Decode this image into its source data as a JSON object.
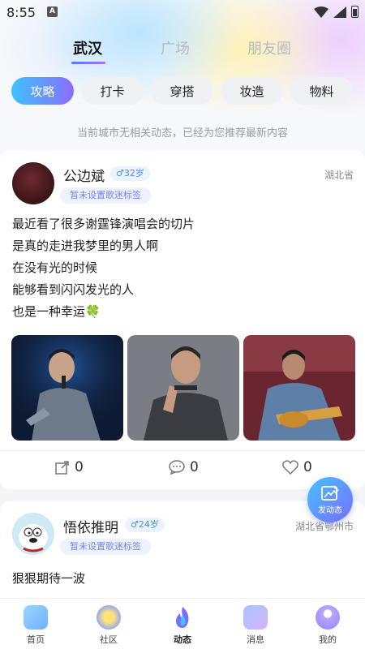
{
  "status_bar": {
    "time": "8:55",
    "notification_letter": "A"
  },
  "location_tabs": [
    {
      "label": "武汉",
      "active": true
    },
    {
      "label": "广场",
      "active": false
    },
    {
      "label": "朋友圈",
      "active": false
    }
  ],
  "category_chips": [
    {
      "label": "攻略",
      "active": true
    },
    {
      "label": "打卡",
      "active": false
    },
    {
      "label": "穿搭",
      "active": false
    },
    {
      "label": "妆造",
      "active": false
    },
    {
      "label": "物料",
      "active": false
    }
  ],
  "notice": "当前城市无相关动态，已经为您推荐最新内容",
  "posts": [
    {
      "username": "公边斌",
      "gender_age": "♂32岁",
      "fan_tag": "暂未设置歌迷标签",
      "location": "湖北省",
      "lines": [
        "最近看了很多谢霆锋演唱会的切片",
        "是真的走进我梦里的男人啊",
        "在没有光的时候",
        "能够看到闪闪发光的人",
        "也是一种幸运🍀"
      ],
      "share_count": "0",
      "comment_count": "0",
      "like_count": "0"
    },
    {
      "username": "悟依推明",
      "gender_age": "♂24岁",
      "fan_tag": "暂未设置歌迷标签",
      "location": "湖北省鄂州市",
      "text": "狠狠期待一波"
    }
  ],
  "fab": {
    "label": "发动态"
  },
  "bottom_nav": [
    {
      "label": "首页",
      "icon": "home-icon"
    },
    {
      "label": "社区",
      "icon": "community-icon"
    },
    {
      "label": "动态",
      "icon": "moments-icon",
      "active": true
    },
    {
      "label": "消息",
      "icon": "message-icon"
    },
    {
      "label": "我的",
      "icon": "profile-icon"
    }
  ],
  "colors": {
    "accent_start": "#3dc3ff",
    "accent_end": "#8b6dff",
    "age_badge": "#4c8ef7"
  }
}
